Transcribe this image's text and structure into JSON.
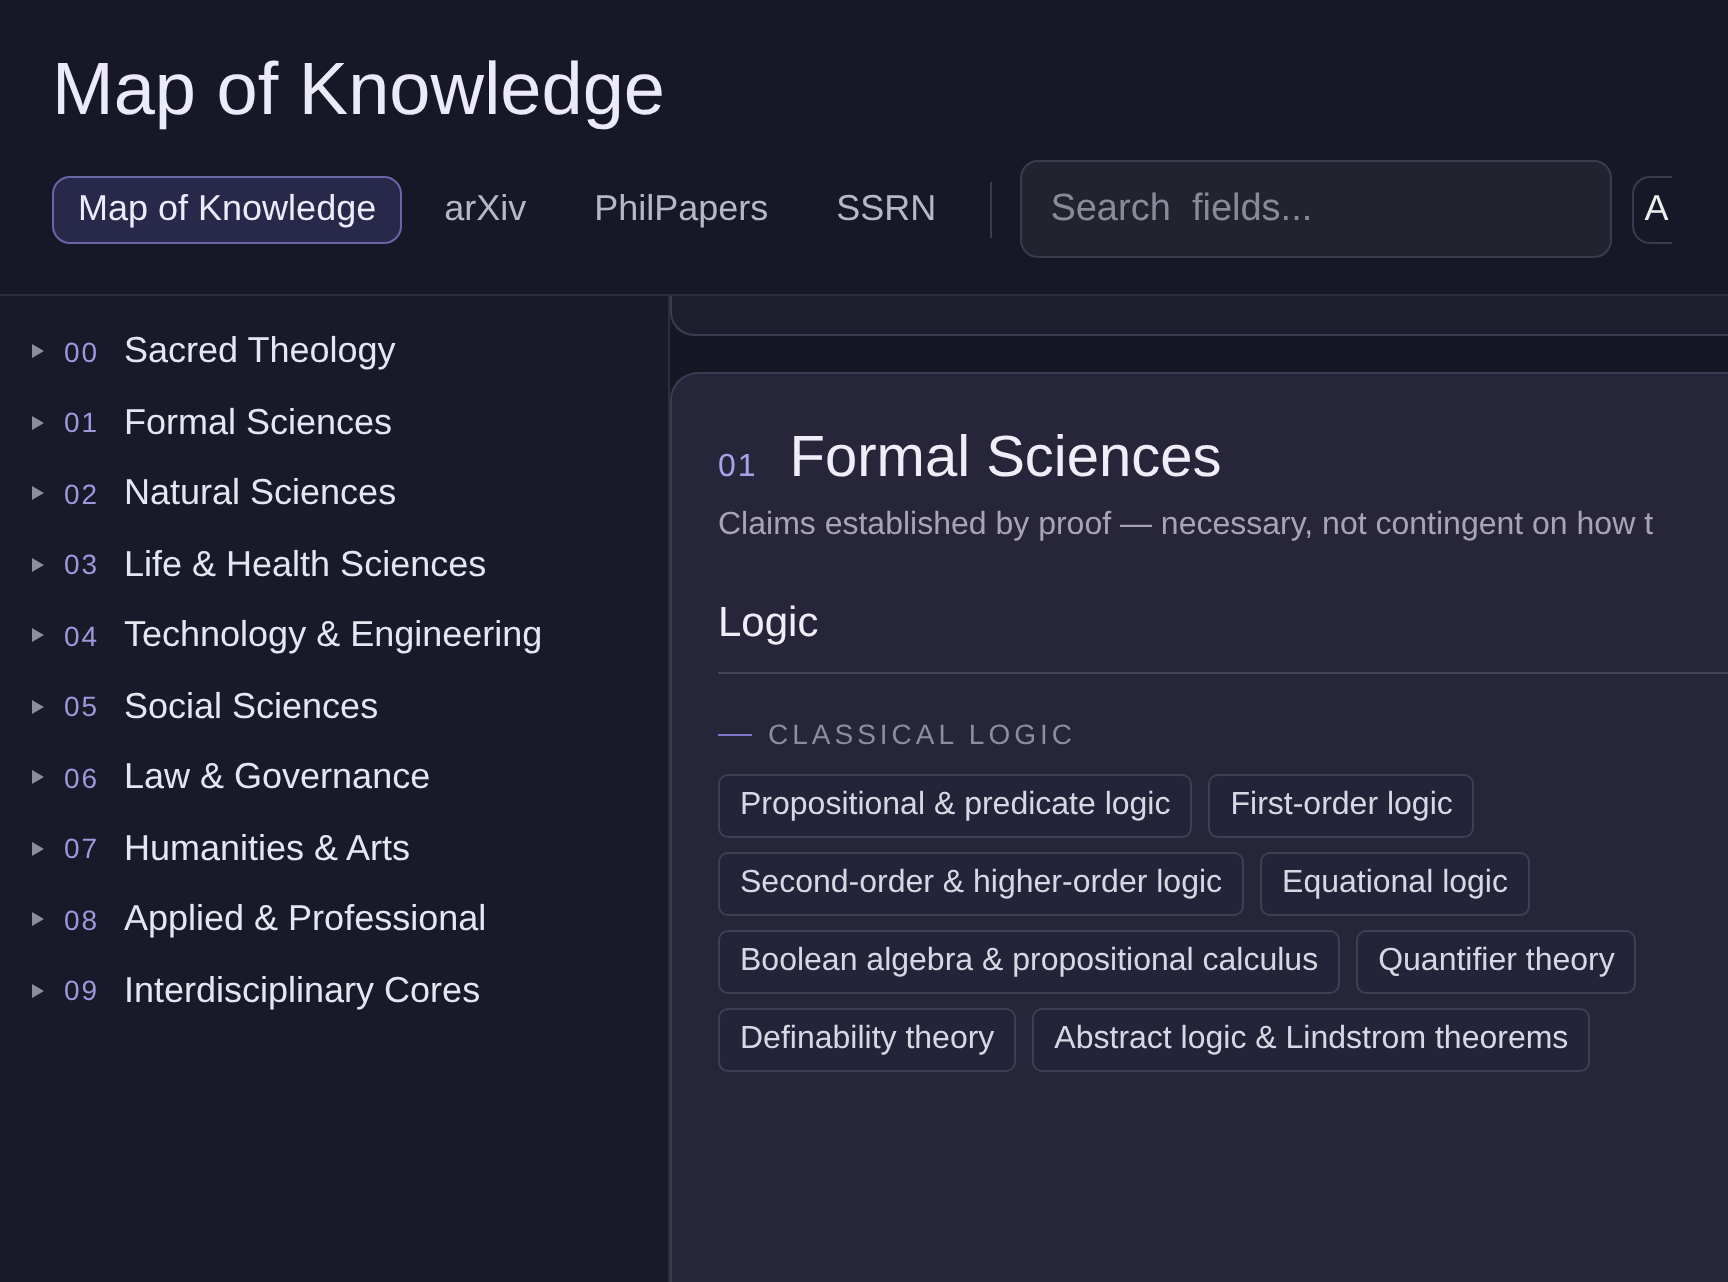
{
  "header": {
    "title": "Map of Knowledge",
    "nav": [
      {
        "label": "Map of Knowledge",
        "selected": true
      },
      {
        "label": "arXiv",
        "selected": false
      },
      {
        "label": "PhilPapers",
        "selected": false
      },
      {
        "label": "SSRN",
        "selected": false
      }
    ],
    "search": {
      "placeholder": "Search  fields..."
    },
    "edge_button": "A"
  },
  "sidebar": {
    "items": [
      {
        "code": "00",
        "label": "Sacred Theology",
        "expanded": false
      },
      {
        "code": "01",
        "label": "Formal Sciences",
        "expanded": false
      },
      {
        "code": "02",
        "label": "Natural Sciences",
        "expanded": false
      },
      {
        "code": "03",
        "label": "Life & Health Sciences",
        "expanded": false
      },
      {
        "code": "04",
        "label": "Technology & Engineering",
        "expanded": false
      },
      {
        "code": "05",
        "label": "Social Sciences",
        "expanded": false
      },
      {
        "code": "06",
        "label": "Law & Governance",
        "expanded": false
      },
      {
        "code": "07",
        "label": "Humanities & Arts",
        "expanded": false
      },
      {
        "code": "08",
        "label": "Applied & Professional",
        "expanded": false
      },
      {
        "code": "09",
        "label": "Interdisciplinary Cores",
        "expanded": false
      }
    ]
  },
  "section": {
    "code": "01",
    "title": "Formal Sciences",
    "description": "Claims established by proof — necessary, not contingent on how t",
    "subsection": {
      "title": "Logic",
      "group": "CLASSICAL LOGIC",
      "tags": [
        "Propositional & predicate logic",
        "First-order logic",
        "Second-order & higher-order logic",
        "Equational logic",
        "Boolean algebra & propositional calculus",
        "Quantifier theory",
        "Definability theory",
        "Abstract logic & Lindstrom theorems"
      ]
    }
  }
}
